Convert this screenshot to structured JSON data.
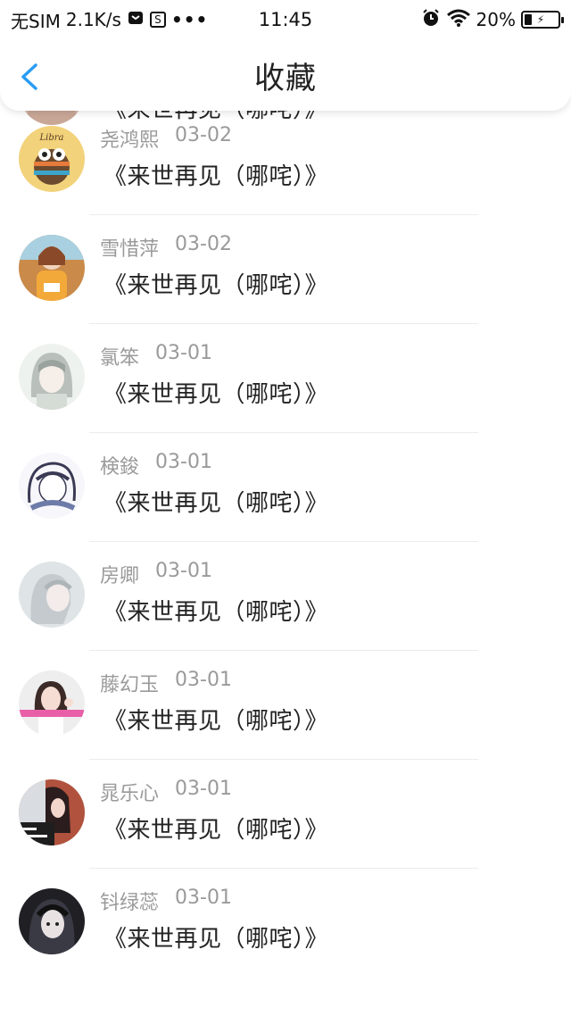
{
  "status_bar": {
    "carrier": "无SIM",
    "speed": "2.1K/s",
    "s_badge": "S",
    "dots": "•••",
    "time": "11:45",
    "battery": "20%",
    "icons": [
      "message-icon",
      "s-icon",
      "more-dots-icon",
      "alarm-icon",
      "wifi-icon",
      "battery-icon"
    ]
  },
  "nav": {
    "title": "收藏",
    "back_icon": "chevron-left-icon",
    "accent": "#2b9cf2"
  },
  "items": [
    {
      "name": "",
      "date": "",
      "title": "《来世再见（哪咤）》",
      "avatar": "avatar-partial"
    },
    {
      "name": "尧鸿熙",
      "date": "03-02",
      "title": "《来世再见（哪咤）》",
      "avatar": "libra-owl-avatar"
    },
    {
      "name": "雪惜萍",
      "date": "03-02",
      "title": "《来世再见（哪咤）》",
      "avatar": "girl-orange-avatar"
    },
    {
      "name": "氯笨",
      "date": "03-01",
      "title": "《来世再见（哪咤）》",
      "avatar": "anime-girl-avatar"
    },
    {
      "name": "検鋑",
      "date": "03-01",
      "title": "《来世再见（哪咤）》",
      "avatar": "sketch-avatar"
    },
    {
      "name": "房卿",
      "date": "03-01",
      "title": "《来世再见（哪咤）》",
      "avatar": "grey-portrait-avatar"
    },
    {
      "name": "藤幻玉",
      "date": "03-01",
      "title": "《来世再见（哪咤）》",
      "avatar": "waving-girl-avatar"
    },
    {
      "name": "晁乐心",
      "date": "03-01",
      "title": "《来世再见（哪咤）》",
      "avatar": "brick-wall-avatar"
    },
    {
      "name": "钭绿蕊",
      "date": "03-01",
      "title": "《来世再见（哪咤）》",
      "avatar": "dark-girl-avatar"
    }
  ]
}
